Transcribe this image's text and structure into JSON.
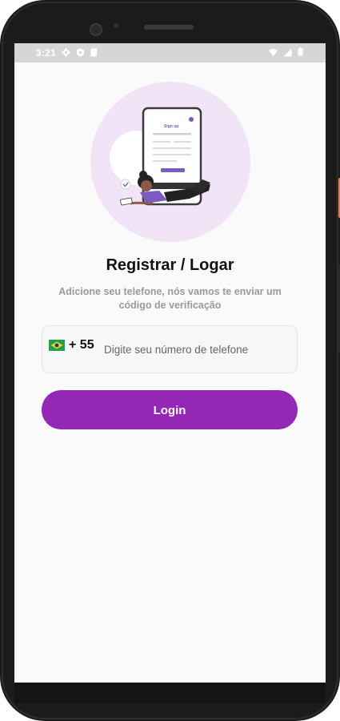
{
  "status_bar": {
    "time": "3:21",
    "left_icons": [
      "gear-icon",
      "shield-icon",
      "sd-card-icon"
    ],
    "right_icons": [
      "wifi-icon",
      "signal-icon",
      "battery-icon"
    ]
  },
  "illustration": {
    "mini_screen_title": "Sign up",
    "subject": "woman lying with tablet in front of large phone showing sign-up form"
  },
  "main": {
    "title": "Registrar / Logar",
    "subtitle": "Adicione seu telefone, nós vamos te enviar um código de verificação"
  },
  "phone_input": {
    "country_flag": "brazil-flag-icon",
    "country_code": "+ 55",
    "placeholder": "Digite seu número de telefone",
    "value": ""
  },
  "login_button": {
    "label": "Login"
  },
  "colors": {
    "primary": "#9427b6",
    "background": "#fafafa",
    "illustration_circle": "#f1e4f7",
    "status_bar": "#d6d6d6"
  }
}
